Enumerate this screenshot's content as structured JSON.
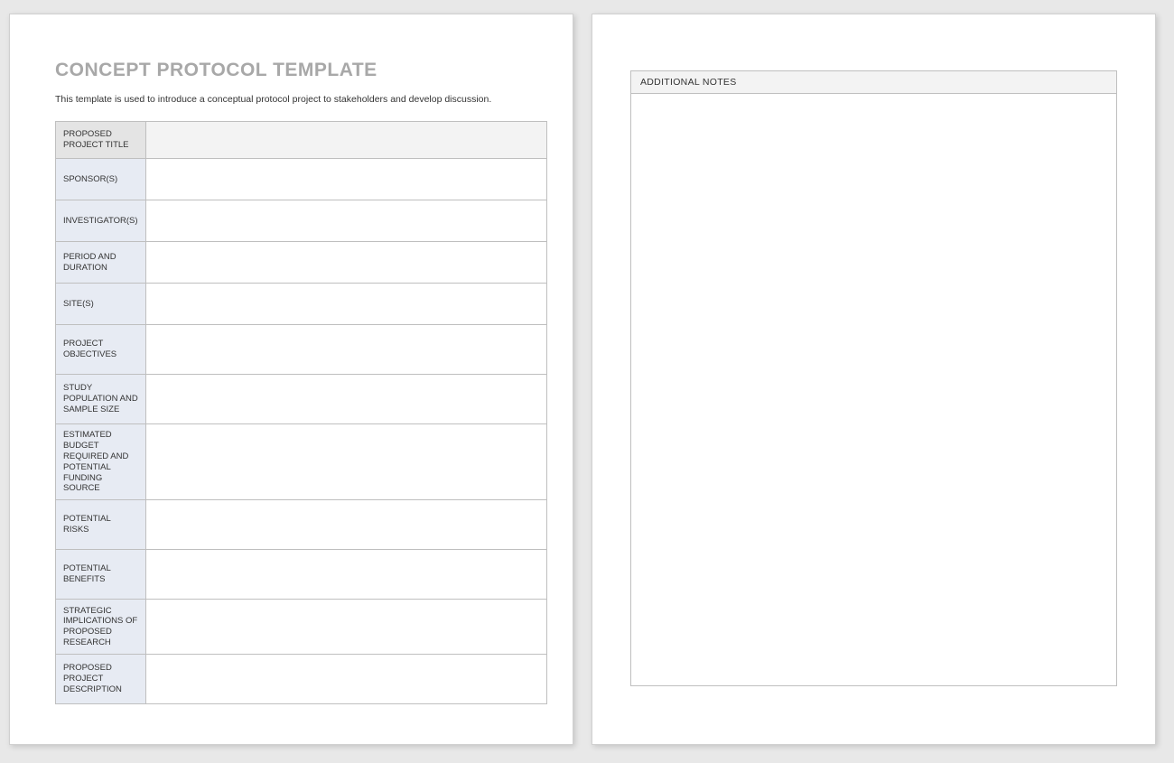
{
  "page1": {
    "title": "CONCEPT PROTOCOL TEMPLATE",
    "intro": "This template is used to introduce a conceptual protocol project to stakeholders and develop discussion.",
    "rows": [
      {
        "label": "PROPOSED PROJECT TITLE",
        "value": "",
        "style": "hdr",
        "height": "r-title"
      },
      {
        "label": "SPONSOR(S)",
        "value": "",
        "style": "norm",
        "height": "r-short"
      },
      {
        "label": "INVESTIGATOR(S)",
        "value": "",
        "style": "norm",
        "height": "r-short"
      },
      {
        "label": "PERIOD AND DURATION",
        "value": "",
        "style": "norm",
        "height": "r-short"
      },
      {
        "label": "SITE(S)",
        "value": "",
        "style": "norm",
        "height": "r-short"
      },
      {
        "label": "PROJECT OBJECTIVES",
        "value": "",
        "style": "norm",
        "height": "r-med"
      },
      {
        "label": "STUDY POPULATION AND SAMPLE SIZE",
        "value": "",
        "style": "norm",
        "height": "r-med"
      },
      {
        "label": "ESTIMATED BUDGET REQUIRED AND POTENTIAL FUNDING SOURCE",
        "value": "",
        "style": "norm",
        "height": "r-tall"
      },
      {
        "label": "POTENTIAL RISKS",
        "value": "",
        "style": "norm",
        "height": "r-med"
      },
      {
        "label": "POTENTIAL BENEFITS",
        "value": "",
        "style": "norm",
        "height": "r-med"
      },
      {
        "label": "STRATEGIC IMPLICATIONS OF PROPOSED RESEARCH",
        "value": "",
        "style": "norm",
        "height": "r-tall"
      },
      {
        "label": "PROPOSED PROJECT DESCRIPTION",
        "value": "",
        "style": "norm",
        "height": "r-med"
      }
    ]
  },
  "page2": {
    "notes_heading": "ADDITIONAL NOTES",
    "notes_body": ""
  }
}
